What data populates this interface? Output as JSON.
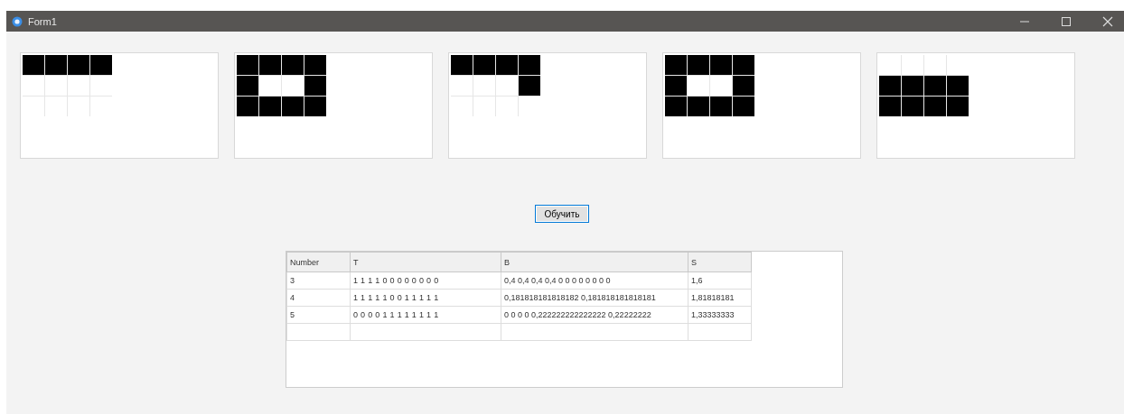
{
  "window": {
    "title": "Form1"
  },
  "grids": [
    {
      "rows": [
        [
          true,
          true,
          true,
          true
        ],
        [
          false,
          false,
          false,
          false
        ],
        [
          false,
          false,
          false,
          false
        ]
      ]
    },
    {
      "rows": [
        [
          true,
          true,
          true,
          true
        ],
        [
          true,
          false,
          false,
          true
        ],
        [
          true,
          true,
          true,
          true
        ]
      ]
    },
    {
      "rows": [
        [
          true,
          true,
          true,
          true
        ],
        [
          false,
          false,
          false,
          true
        ],
        [
          false,
          false,
          false,
          false
        ]
      ]
    },
    {
      "rows": [
        [
          true,
          true,
          true,
          true
        ],
        [
          true,
          false,
          false,
          true
        ],
        [
          true,
          true,
          true,
          true
        ]
      ]
    },
    {
      "rows": [
        [
          false,
          false,
          false,
          false
        ],
        [
          true,
          true,
          true,
          true
        ],
        [
          true,
          true,
          true,
          true
        ]
      ]
    }
  ],
  "train_button": "Обучить",
  "table": {
    "columns": [
      "Number",
      "T",
      "B",
      "S"
    ],
    "rows": [
      [
        "3",
        "1 1 1 1 0 0 0 0 0 0 0 0",
        "0,4 0,4 0,4 0,4 0 0 0 0 0 0 0 0",
        "1,6"
      ],
      [
        "4",
        "1 1 1 1 1 0 0 1 1 1 1 1",
        "0,181818181818182 0,181818181818181",
        "1,81818181"
      ],
      [
        "5",
        "0 0 0 0 1 1 1 1 1 1 1 1",
        "0 0 0 0 0,222222222222222 0,22222222",
        "1,33333333"
      ]
    ]
  }
}
